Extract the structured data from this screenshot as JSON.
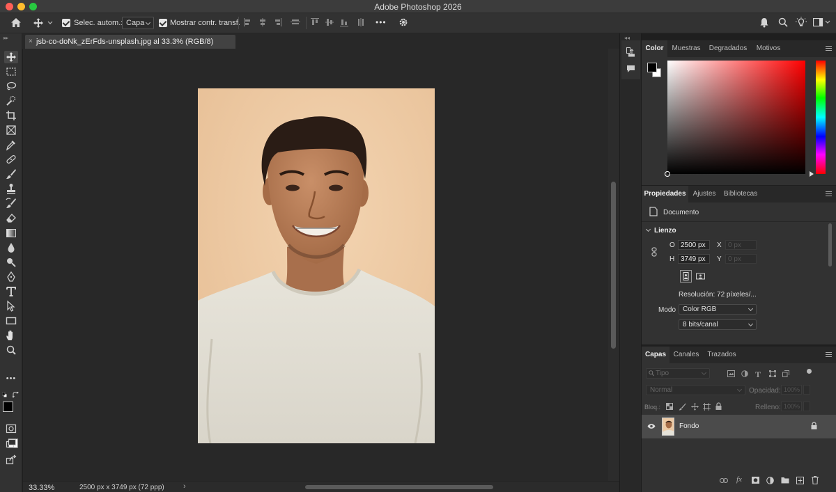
{
  "window": {
    "title": "Adobe Photoshop 2026"
  },
  "options_bar": {
    "auto_select_label": "Selec. autom.:",
    "auto_select_value": "Capa",
    "show_transform_label": "Mostrar contr. transf.",
    "more_label": "•••"
  },
  "document": {
    "tab_title": "jsb-co-doNk_zErFds-unsplash.jpg al 33.3% (RGB/8)",
    "close_glyph": "×"
  },
  "status": {
    "zoom": "33.33%",
    "info": "2500 px x 3749 px (72 ppp)",
    "arrow": "›"
  },
  "toolbar": {
    "more_label": "•••"
  },
  "color_panel": {
    "tabs": [
      "Color",
      "Muestras",
      "Degradados",
      "Motivos"
    ],
    "active_tab": "Color",
    "foreground": "#000000",
    "background": "#ffffff"
  },
  "properties_panel": {
    "tabs": [
      "Propiedades",
      "Ajustes",
      "Bibliotecas"
    ],
    "active_tab": "Propiedades",
    "doc_label": "Documento",
    "section": "Lienzo",
    "width_label": "O",
    "width_value": "2500 px",
    "height_label": "H",
    "height_value": "3749 px",
    "x_label": "X",
    "x_placeholder": "0 px",
    "y_label": "Y",
    "y_placeholder": "0 px",
    "resolution": "Resolución: 72 píxeles/...",
    "mode_label": "Modo",
    "mode_value": "Color RGB",
    "depth_value": "8 bits/canal"
  },
  "layers_panel": {
    "tabs": [
      "Capas",
      "Canales",
      "Trazados"
    ],
    "active_tab": "Capas",
    "filter_placeholder": "Tipo",
    "blend_mode": "Normal",
    "opacity_label": "Opacidad:",
    "opacity_value": "100%",
    "lock_label": "Bloq.:",
    "fill_label": "Relleno:",
    "fill_value": "100%",
    "layers": [
      {
        "name": "Fondo",
        "visible": true,
        "locked": true
      }
    ]
  }
}
